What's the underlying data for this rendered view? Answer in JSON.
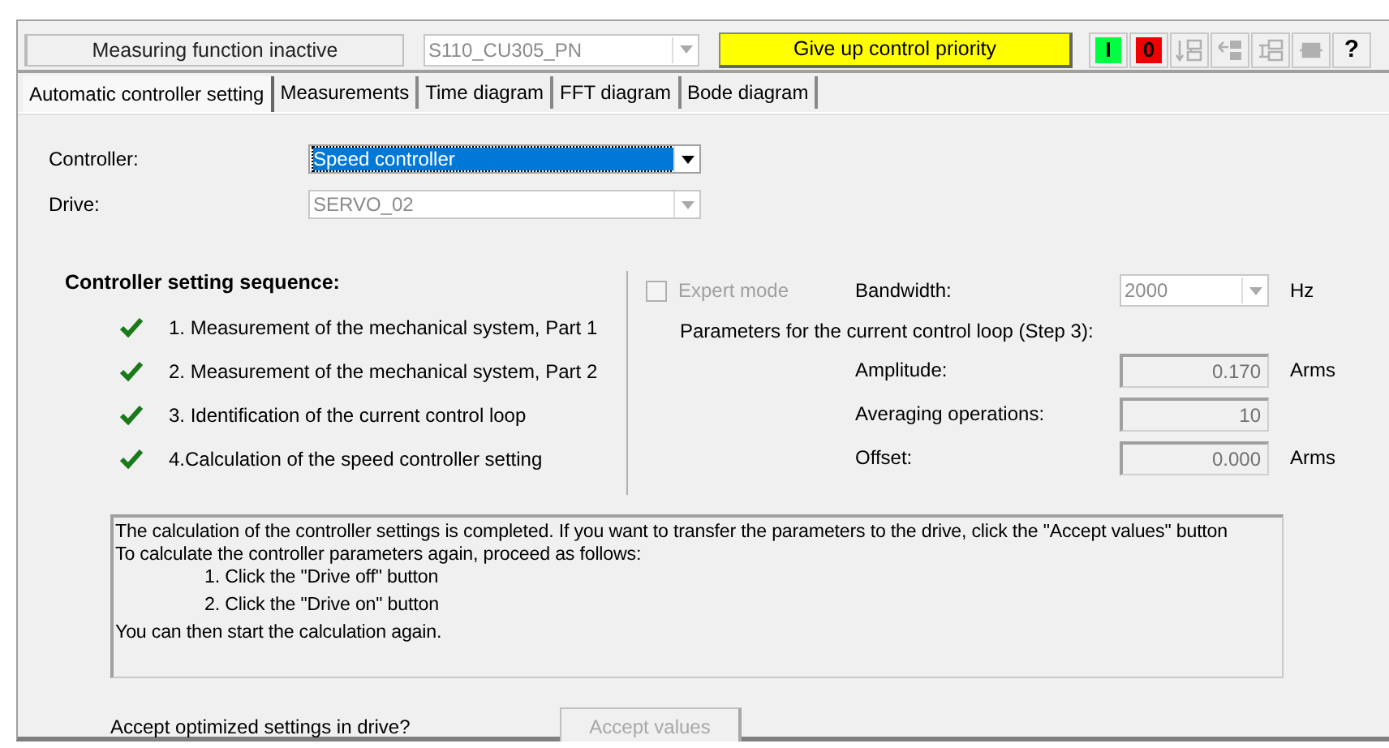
{
  "toolbar": {
    "status": "Measuring function inactive",
    "device": {
      "value": "S110_CU305_PN",
      "disabled": true
    },
    "priority_button": "Give up control priority",
    "buttons": [
      {
        "kind": "on",
        "label": "I",
        "disabled": false
      },
      {
        "kind": "off",
        "label": "0",
        "disabled": false
      },
      {
        "kind": "tree-down",
        "disabled": true
      },
      {
        "kind": "tree-left",
        "disabled": true
      },
      {
        "kind": "tree-both",
        "disabled": true
      },
      {
        "kind": "block",
        "disabled": true
      },
      {
        "kind": "help",
        "label": "?",
        "disabled": false
      }
    ]
  },
  "tabs": [
    {
      "label": "Automatic controller setting",
      "selected": true
    },
    {
      "label": "Measurements",
      "selected": false
    },
    {
      "label": "Time diagram",
      "selected": false
    },
    {
      "label": "FFT diagram",
      "selected": false
    },
    {
      "label": "Bode diagram",
      "selected": false
    }
  ],
  "controller": {
    "label": "Controller:",
    "value": "Speed controller",
    "disabled": false
  },
  "drive": {
    "label": "Drive:",
    "value": "SERVO_02",
    "disabled": true
  },
  "sequence": {
    "title": "Controller setting sequence:",
    "steps": [
      {
        "text": "1. Measurement of the mechanical system, Part 1",
        "checked": true
      },
      {
        "text": "2. Measurement of the mechanical system, Part 2",
        "checked": true
      },
      {
        "text": "3. Identification of the current control loop",
        "checked": true
      },
      {
        "text": "4.Calculation of the speed controller setting",
        "checked": true
      }
    ]
  },
  "expert_mode": {
    "label": "Expert mode",
    "checked": false,
    "disabled": true
  },
  "bandwidth": {
    "label": "Bandwidth:",
    "value": "2000",
    "unit": "Hz",
    "disabled": true
  },
  "parameters": {
    "title": "Parameters for the current control loop (Step 3):",
    "rows": [
      {
        "label": "Amplitude:",
        "value": "0.170",
        "unit": "Arms"
      },
      {
        "label": "Averaging operations:",
        "value": "10"
      },
      {
        "label": "Offset:",
        "value": "0.000",
        "unit": "Arms"
      }
    ]
  },
  "message": [
    {
      "text": "The calculation of the controller settings is completed. If you want to transfer the parameters to the drive, click the \"Accept values\" button",
      "kind": "plain"
    },
    {
      "text": "To calculate the controller parameters again, proceed as follows:",
      "kind": "plain"
    },
    {
      "text": "1. Click the \"Drive off\" button",
      "kind": "step"
    },
    {
      "text": "2. Click the \"Drive on\" button",
      "kind": "step"
    },
    {
      "text": "You can then start the calculation again.",
      "kind": "plain"
    }
  ],
  "accept": {
    "label": "Accept optimized settings in drive?",
    "button": "Accept values",
    "disabled": true
  }
}
